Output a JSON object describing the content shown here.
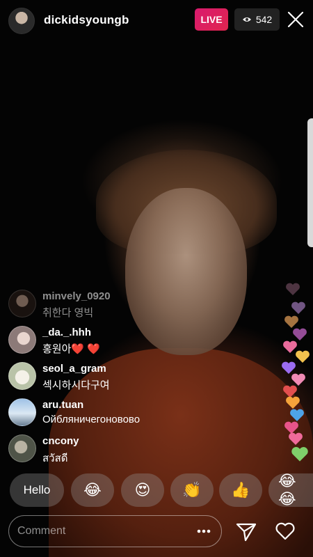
{
  "header": {
    "username": "dickidsyoungb",
    "live_label": "LIVE",
    "viewer_count": "542"
  },
  "comments": [
    {
      "user": "minvely_0920",
      "text": "취한다 영빅",
      "faded": true
    },
    {
      "user": "_da._.hhh",
      "text": "홍원아",
      "hearts": "❤️ ❤️"
    },
    {
      "user": "seol_a_gram",
      "text": "섹시하시다구여"
    },
    {
      "user": "aru.tuan",
      "text": "Ойбляничегоновово"
    },
    {
      "user": "cnсony",
      "text": "สวัสดี"
    }
  ],
  "reactions": [
    {
      "label": "Hello"
    },
    {
      "emoji": "😂"
    },
    {
      "emoji": "😍"
    },
    {
      "emoji": "👏"
    },
    {
      "emoji": "👍"
    },
    {
      "emoji": "😂😂"
    }
  ],
  "input": {
    "placeholder": "Comment"
  },
  "colors": {
    "live_badge": "#e0225a",
    "accent_heart": "#e02424"
  },
  "icons": [
    "eye-icon",
    "close-icon",
    "more-icon",
    "send-icon",
    "heart-outline-icon"
  ]
}
